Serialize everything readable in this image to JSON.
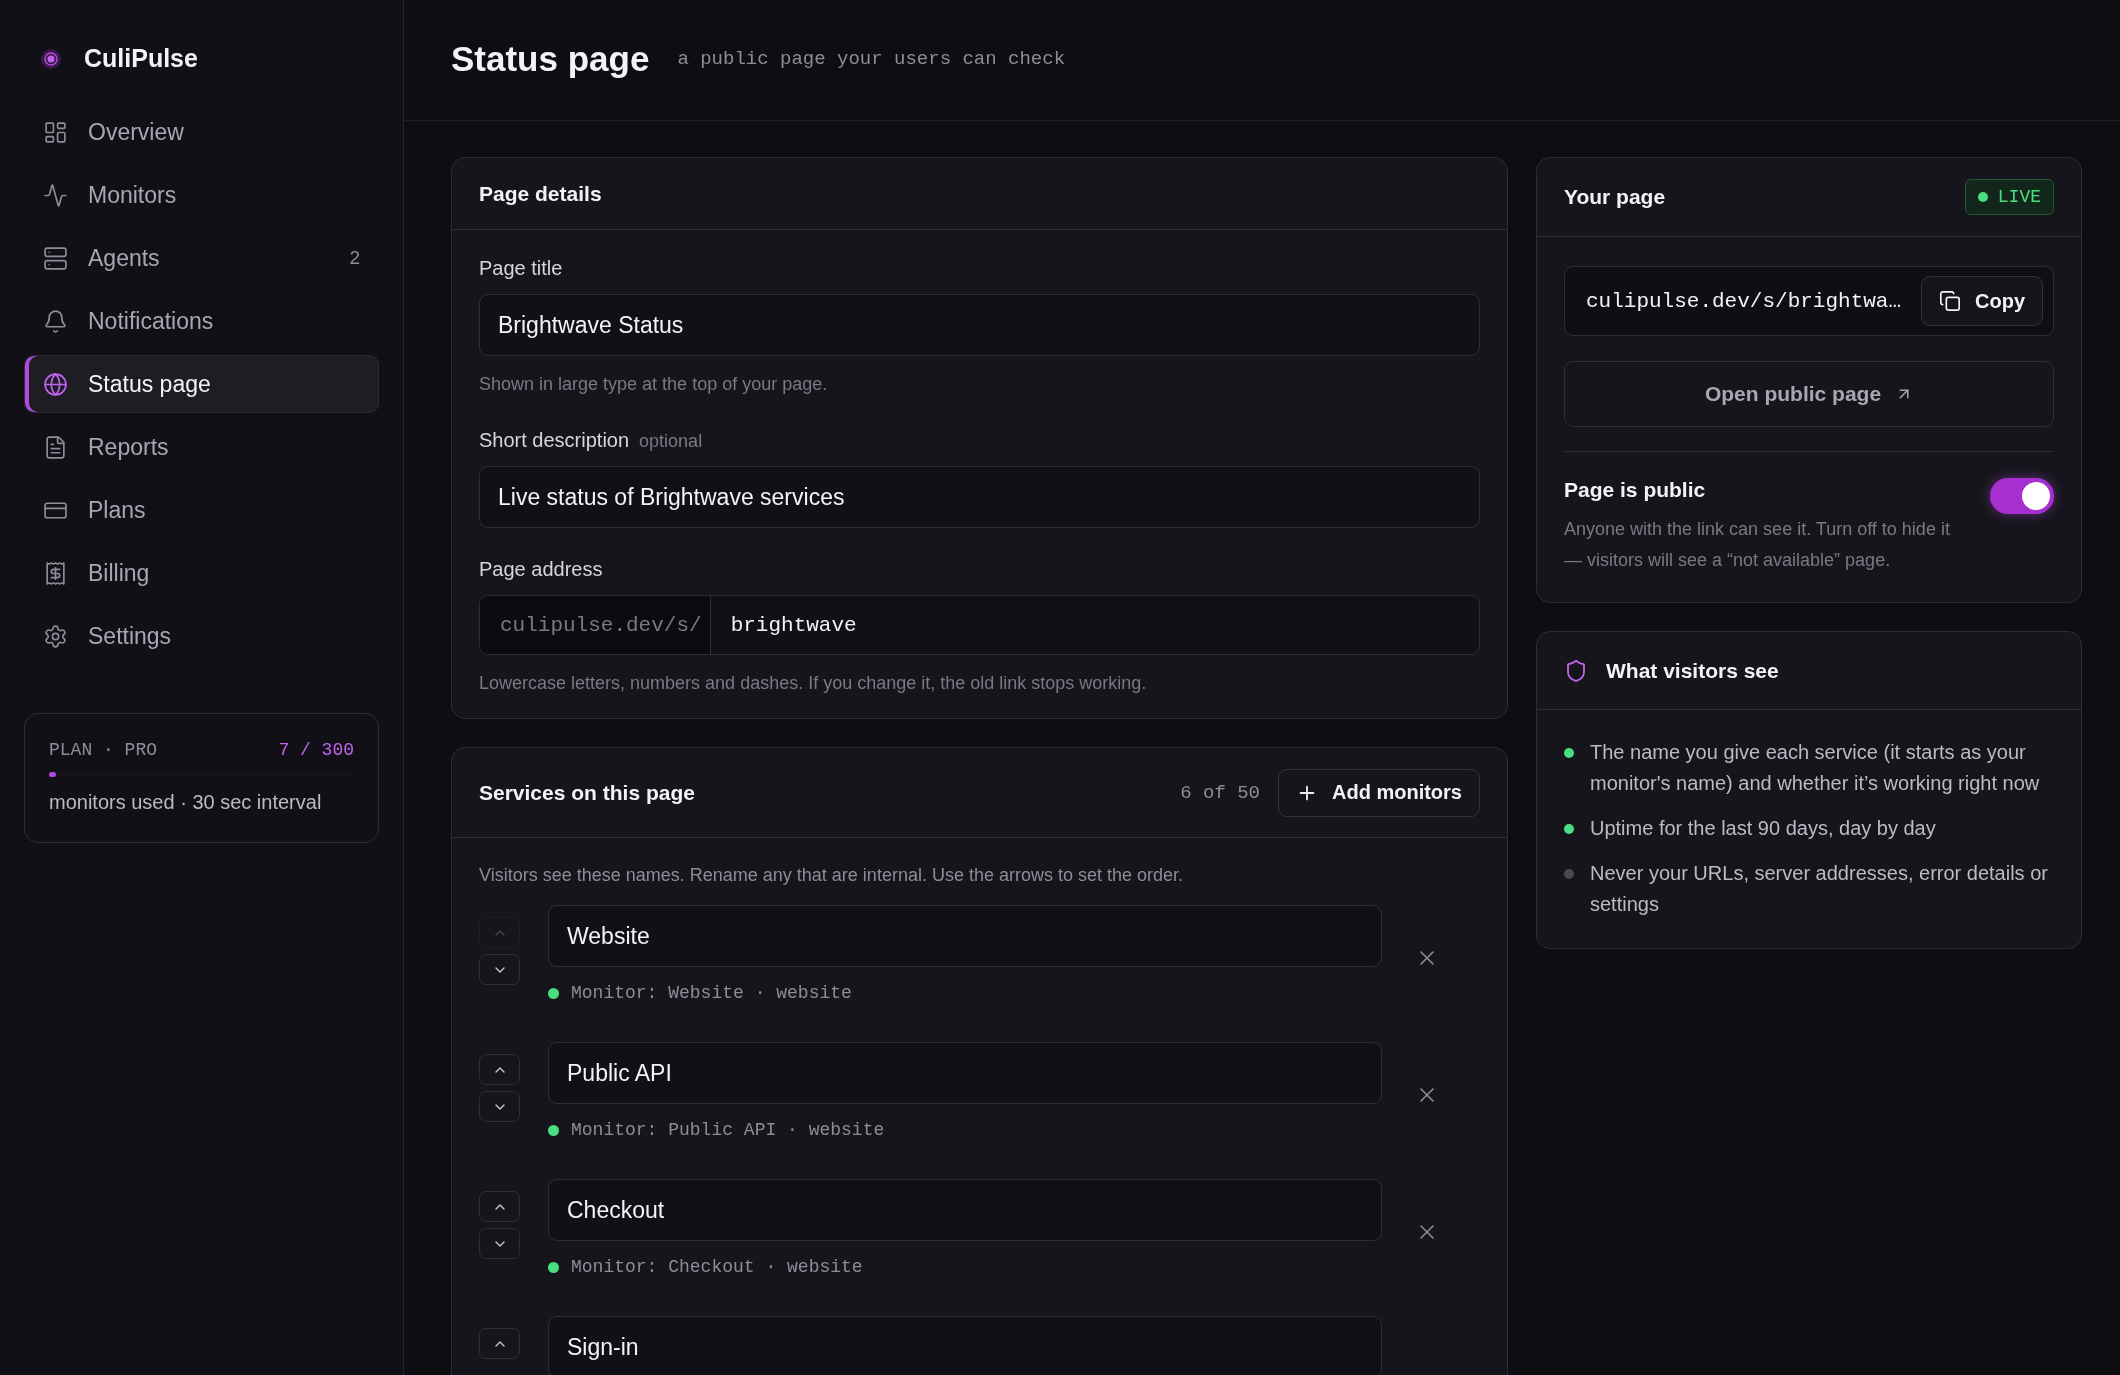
{
  "sidebar": {
    "brand": "CuliPulse",
    "items": [
      {
        "label": "Overview",
        "selected": false
      },
      {
        "label": "Monitors",
        "selected": false
      },
      {
        "label": "Agents",
        "selected": false,
        "badge": "2"
      },
      {
        "label": "Notifications",
        "selected": false
      },
      {
        "label": "Status page",
        "selected": true
      },
      {
        "label": "Reports",
        "selected": false
      },
      {
        "label": "Plans",
        "selected": false
      },
      {
        "label": "Billing",
        "selected": false
      },
      {
        "label": "Settings",
        "selected": false
      }
    ],
    "plan": {
      "label": "PLAN · PRO",
      "usage": "7 / 300",
      "level": 0.023,
      "caption": "monitors used · 30 sec interval"
    }
  },
  "header": {
    "title": "Status page",
    "subtitle": "a public page your users can check"
  },
  "page_details": {
    "title": "Page details",
    "page_title": {
      "label": "Page title",
      "value": "Brightwave Status",
      "hint": "Shown in large type at the top of your page."
    },
    "description": {
      "label": "Short description",
      "optional": "optional",
      "value": "Live status of Brightwave services"
    },
    "address": {
      "label": "Page address",
      "prefix": "culipulse.dev/s/",
      "value": "brightwave",
      "hint": "Lowercase letters, numbers and dashes. If you change it, the old link stops working."
    }
  },
  "services": {
    "title": "Services on this page",
    "count": "6 of 50",
    "add_button": "Add monitors",
    "description": "Visitors see these names. Rename any that are internal. Use the arrows to set the order.",
    "rows": [
      {
        "name": "Website",
        "monitor": "Monitor: Website · website",
        "up_disabled": true,
        "color": "#4ade80"
      },
      {
        "name": "Public API",
        "monitor": "Monitor: Public API · website",
        "up_disabled": false,
        "color": "#4ade80"
      },
      {
        "name": "Checkout",
        "monitor": "Monitor: Checkout · website",
        "up_disabled": false,
        "color": "#4ade80"
      },
      {
        "name": "Sign-in",
        "up_disabled": false
      }
    ]
  },
  "your_page": {
    "title": "Your page",
    "badge": "LIVE",
    "url": "culipulse.dev/s/brightwa…",
    "copy_button": "Copy",
    "open_button": "Open public page",
    "public": {
      "label": "Page is public",
      "on": true,
      "description": "Anyone with the link can see it. Turn off to hide it — visitors will see a “not available” page."
    }
  },
  "visitors": {
    "title": "What visitors see",
    "items": [
      {
        "text": "The name you give each service (it starts as your monitor's name) and whether it’s working right now",
        "included": true
      },
      {
        "text": "Uptime for the last 90 days, day by day",
        "included": true
      },
      {
        "text": "Never your URLs, server addresses, error details or settings",
        "included": false
      }
    ]
  }
}
